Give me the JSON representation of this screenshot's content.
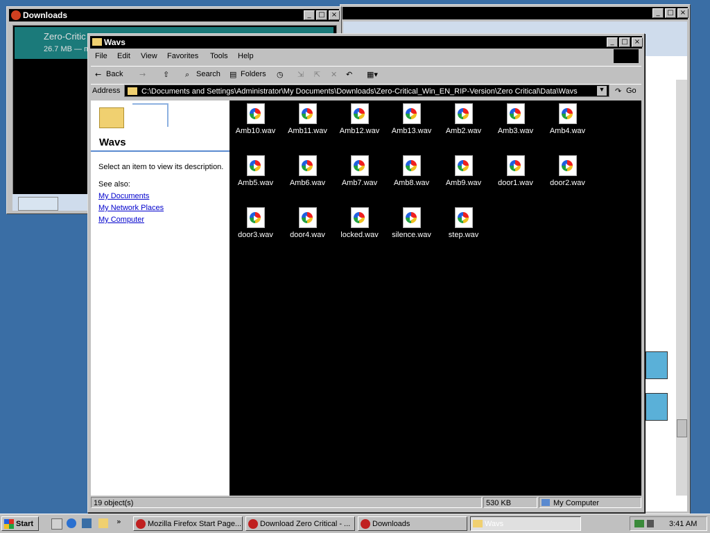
{
  "background_window": {
    "buttons": [
      "_",
      "□",
      "×"
    ]
  },
  "downloads_window": {
    "title": "Downloads",
    "item_name": "Zero-Critic",
    "item_size": "26.7 MB — m",
    "buttons": [
      "_",
      "□",
      "×"
    ]
  },
  "explorer": {
    "title": "Wavs",
    "buttons": [
      "_",
      "□",
      "×"
    ],
    "menu": [
      "File",
      "Edit",
      "View",
      "Favorites",
      "Tools",
      "Help"
    ],
    "toolbar": {
      "back": "Back",
      "search": "Search",
      "folders": "Folders"
    },
    "address": {
      "label": "Address",
      "value": "C:\\Documents and Settings\\Administrator\\My Documents\\Downloads\\Zero-Critical_Win_EN_RIP-Version\\Zero Critical\\Data\\Wavs",
      "go": "Go"
    },
    "left_pane": {
      "folder_title": "Wavs",
      "description": "Select an item to view its description.",
      "see_also": "See also:",
      "links": [
        "My Documents",
        "My Network Places",
        "My Computer"
      ]
    },
    "files": [
      "Amb10.wav",
      "Amb11.wav",
      "Amb12.wav",
      "Amb13.wav",
      "Amb2.wav",
      "Amb3.wav",
      "Amb4.wav",
      "Amb5.wav",
      "Amb6.wav",
      "Amb7.wav",
      "Amb8.wav",
      "Amb9.wav",
      "door1.wav",
      "door2.wav",
      "door3.wav",
      "door4.wav",
      "locked.wav",
      "silence.wav",
      "step.wav"
    ],
    "status": {
      "objects": "19 object(s)",
      "size": "530 KB",
      "location": "My Computer"
    }
  },
  "taskbar": {
    "start": "Start",
    "tasks": [
      "Mozilla Firefox Start Page...",
      "Download Zero Critical - ...",
      "Downloads",
      "Wavs"
    ],
    "clock": "3:41 AM"
  }
}
